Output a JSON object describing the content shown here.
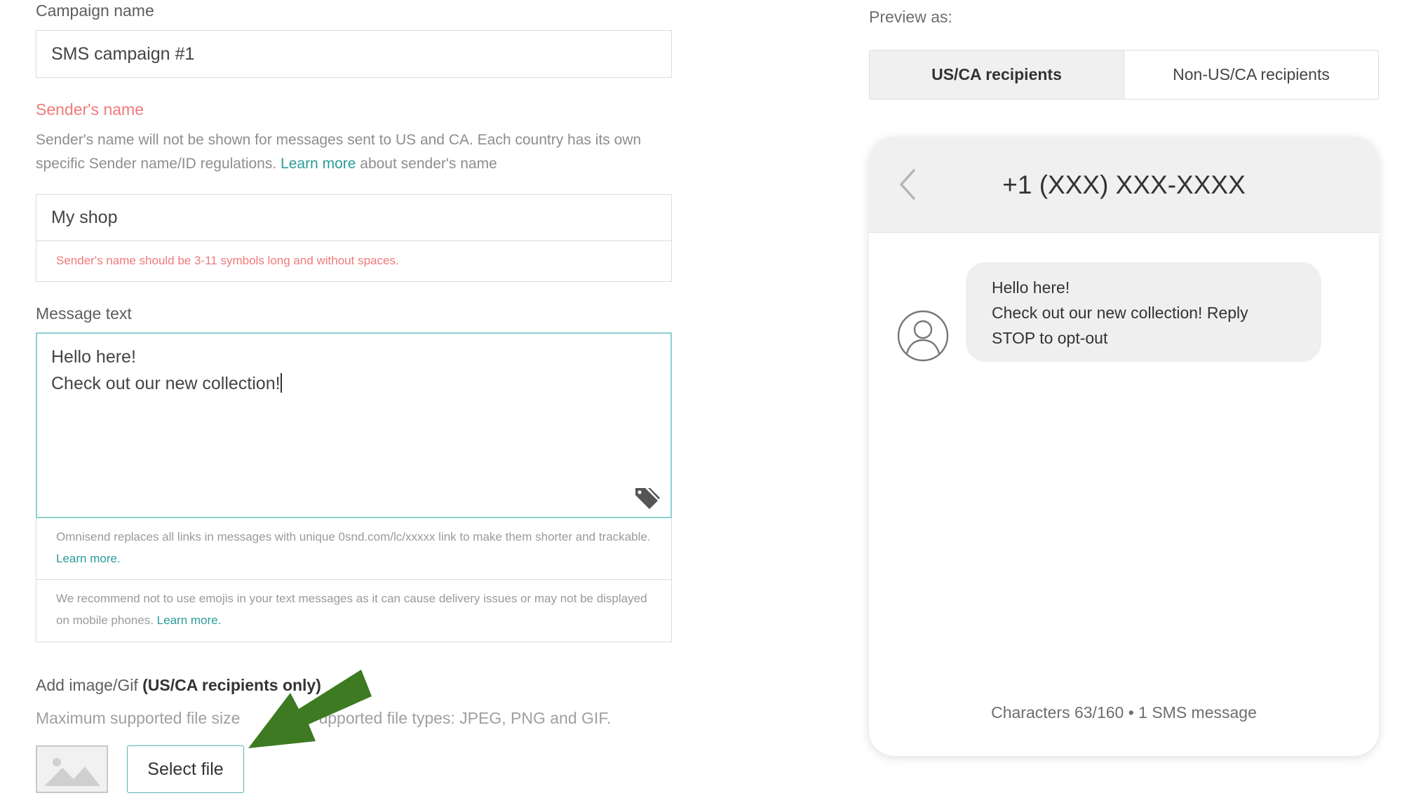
{
  "form": {
    "campaign_name": {
      "label": "Campaign name",
      "value": "SMS campaign #1"
    },
    "sender_name": {
      "label": "Sender's name",
      "help_part1": "Sender's name will not be shown for messages sent to US and CA. Each country has its own specific Sender name/ID regulations.",
      "help_link": "Learn more",
      "help_part2": "about sender's name",
      "value": "My shop",
      "error": "Sender's name should be 3-11 symbols long and without spaces."
    },
    "message": {
      "label": "Message text",
      "line1": "Hello here!",
      "line2": "Check out our new collection!",
      "note_links_text": "Omnisend replaces all links in messages with unique 0snd.com/lc/xxxxx link to make them shorter and trackable.",
      "note_links_link": "Learn more.",
      "note_emoji_text": "We recommend not to use emojis in your text messages as it can cause delivery issues or may not be displayed on mobile phones.",
      "note_emoji_link": "Learn more."
    },
    "image": {
      "label_part1": "Add image/Gif",
      "label_bold": "(US/CA recipients only)",
      "help_part1": "Maximum supported file size",
      "help_part2": "upported file types: JPEG, PNG and GIF.",
      "select_label": "Select file"
    }
  },
  "preview": {
    "label": "Preview as:",
    "tabs": [
      {
        "label": "US/CA recipients",
        "active": true
      },
      {
        "label": "Non-US/CA recipients",
        "active": false
      }
    ],
    "phone_number": "+1 (XXX) XXX-XXXX",
    "bubble_lines": [
      "Hello here!",
      "Check out our new collection! Reply",
      "STOP to opt-out"
    ],
    "char_count": "Characters 63/160 • 1 SMS message"
  },
  "colors": {
    "accent": "#2a9b9b",
    "error": "#ef7a7a",
    "arrow": "#3d7a22"
  }
}
